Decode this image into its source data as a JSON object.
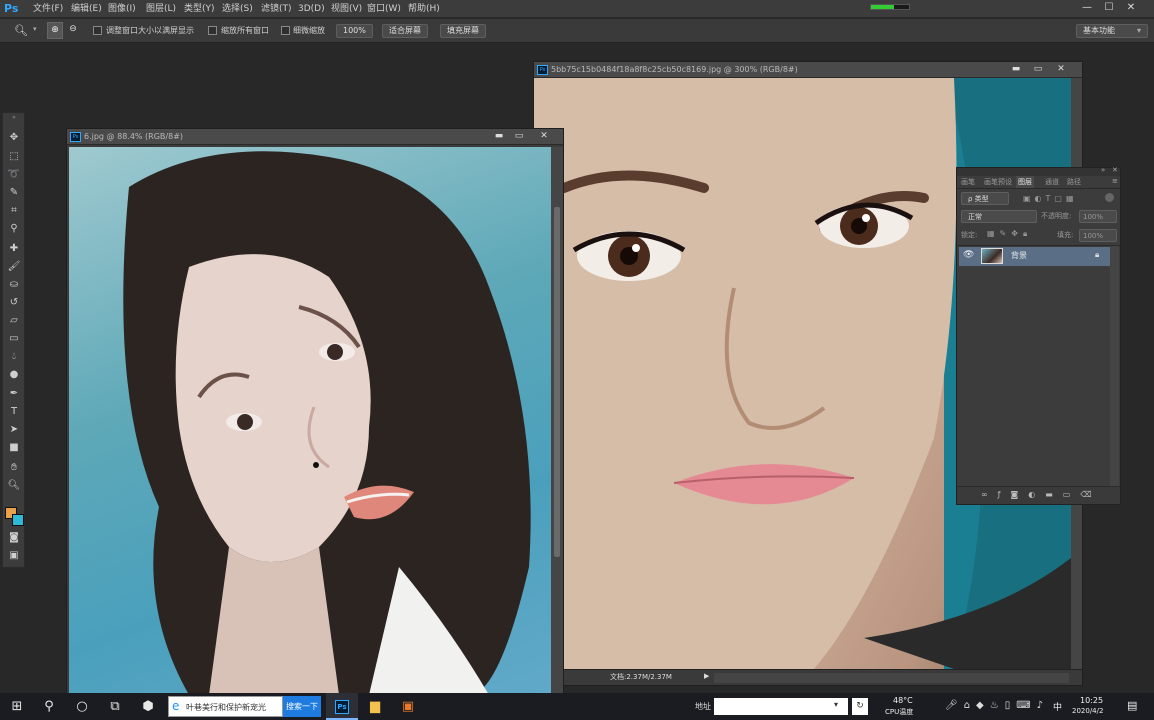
{
  "app": {
    "logo": "Ps"
  },
  "menu": [
    "文件(F)",
    "编辑(E)",
    "图像(I)",
    "图层(L)",
    "类型(Y)",
    "选择(S)",
    "滤镜(T)",
    "3D(D)",
    "视图(V)",
    "窗口(W)",
    "帮助(H)"
  ],
  "window_buttons": {
    "minimize": "—",
    "maximize": "☐",
    "close": "✕"
  },
  "options_bar": {
    "chk1": "调整窗口大小以满屏显示",
    "chk2": "缩放所有窗口",
    "chk3": "细微缩放",
    "zoom_pct": "100%",
    "fit_screen": "适合屏幕",
    "fill_screen": "填充屏幕",
    "workspace": "基本功能"
  },
  "documents": {
    "left": {
      "title": "6.jpg @ 88.4% (RGB/8#)"
    },
    "right": {
      "title": "5bb75c15b0484f18a8f8c25cb50c8169.jpg @ 300% (RGB/8#)",
      "status": "文档:2.37M/2.37M"
    }
  },
  "layers_panel": {
    "tabs": [
      "画笔",
      "画笔预设",
      "图层",
      "通道",
      "路径"
    ],
    "active_tab": "图层",
    "filter_kind": "ρ 类型",
    "blend_mode": "正常",
    "opacity_label": "不透明度:",
    "opacity": "100%",
    "lock_label": "锁定:",
    "fill_label": "填充:",
    "fill": "100%",
    "layers": [
      {
        "name": "背景"
      }
    ]
  },
  "taskbar": {
    "search_text": "叶巷美行和保护新宠光",
    "search_button": "搜索一下",
    "address_label": "地址",
    "temperature": "48°C",
    "cpu_label": "CPU温度",
    "time": "10:25",
    "date": "2020/4/2",
    "lang": "中"
  },
  "colors": {
    "accent": "#31a8ff",
    "foreground_swatch": "#e8a04a",
    "background_swatch": "#2fb8d8"
  }
}
